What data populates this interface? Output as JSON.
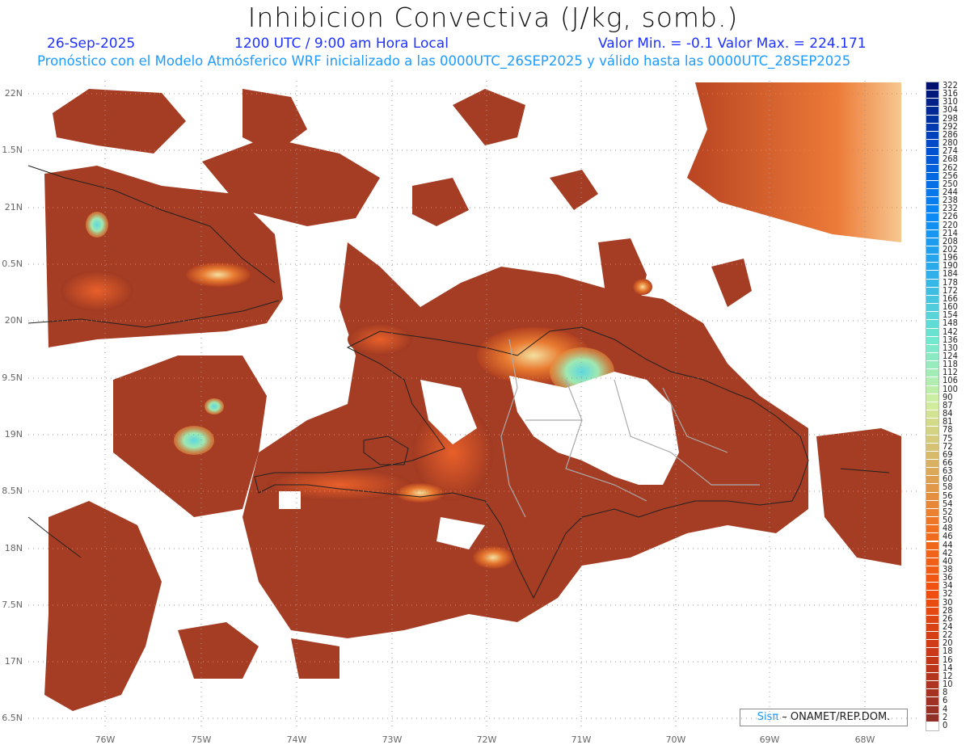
{
  "header": {
    "title": "Inhibicion Convectiva (J/kg, somb.)",
    "date": "26-Sep-2025",
    "time": "1200 UTC / 9:00 am Hora Local",
    "minmax": "Valor Min. = -0.1  Valor Max. = 224.171",
    "subtitle": "Pronóstico con el Modelo Atmósferico WRF inicializado a las 0000UTC_26SEP2025 y válido hasta las  0000UTC_28SEP2025"
  },
  "lat_labels": [
    "22N",
    "1.5N",
    "21N",
    "0.5N",
    "20N",
    "9.5N",
    "19N",
    "8.5N",
    "18N",
    "7.5N",
    "17N",
    "6.5N"
  ],
  "lon_labels": [
    "76W",
    "75W",
    "74W",
    "73W",
    "72W",
    "71W",
    "70W",
    "69W",
    "68W"
  ],
  "colorbar": {
    "labels": [
      "322",
      "316",
      "310",
      "304",
      "298",
      "292",
      "286",
      "280",
      "274",
      "268",
      "262",
      "256",
      "250",
      "244",
      "238",
      "232",
      "226",
      "220",
      "214",
      "208",
      "202",
      "196",
      "190",
      "184",
      "178",
      "172",
      "166",
      "160",
      "154",
      "148",
      "142",
      "136",
      "130",
      "124",
      "118",
      "112",
      "106",
      "100",
      "90",
      "87",
      "84",
      "81",
      "78",
      "75",
      "72",
      "69",
      "66",
      "63",
      "60",
      "58",
      "56",
      "54",
      "52",
      "50",
      "48",
      "46",
      "44",
      "42",
      "40",
      "38",
      "36",
      "34",
      "32",
      "30",
      "28",
      "26",
      "24",
      "22",
      "20",
      "18",
      "16",
      "14",
      "12",
      "10",
      "8",
      "6",
      "4",
      "2",
      "0"
    ],
    "stops": [
      "#00106e",
      "#0050d0",
      "#0a88f5",
      "#30b0e8",
      "#70e8d0",
      "#d0f0a0",
      "#d8b060",
      "#f07020",
      "#f05010",
      "#c83818",
      "#903028"
    ]
  },
  "credit": {
    "brand": "Sisπ",
    "text": " – ONAMET/REP.DOM."
  }
}
